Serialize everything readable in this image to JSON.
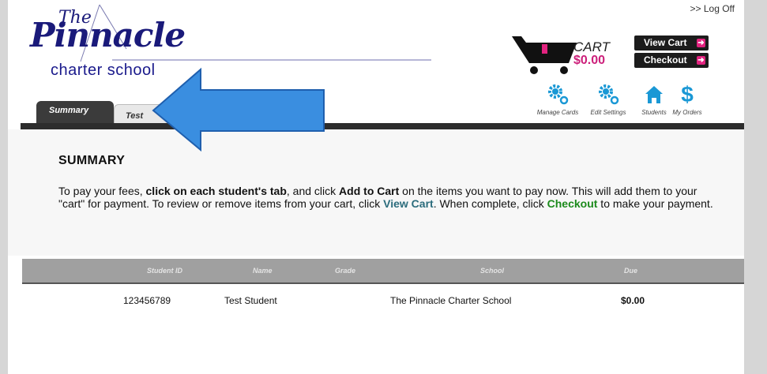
{
  "header": {
    "logo": {
      "the": "The",
      "name": "Pinnacle",
      "subtitle": "charter  school"
    },
    "logoff": ">> Log Off",
    "cart": {
      "label": "CART",
      "total": "$0.00"
    },
    "buttons": {
      "view_cart": "View Cart",
      "checkout": "Checkout",
      "arrow_glyph": "➜"
    },
    "icon_links": [
      {
        "label": "Manage Cards",
        "icon": "gear-icon"
      },
      {
        "label": "Edit Settings",
        "icon": "gear-icon"
      },
      {
        "label": "Students",
        "icon": "home-icon"
      },
      {
        "label": "My Orders",
        "icon": "dollar-icon"
      }
    ],
    "colors": {
      "accent": "#e2237f",
      "icon_blue": "#1a98d5",
      "dark": "#1c1c1c"
    }
  },
  "tabs": [
    {
      "label": "Summary",
      "active": true
    },
    {
      "label": "Test",
      "active": false
    }
  ],
  "summary": {
    "title": "SUMMARY",
    "instr": {
      "p1": "To pay your fees, ",
      "b1": "click on each student's tab",
      "p2": ", and click ",
      "b2": "Add to Cart",
      "p3": " on the items you want to pay now. This will add them to your \"cart\" for payment. To review or remove items from your cart, click ",
      "b3": "View Cart",
      "p4": ". When complete, click ",
      "b4": "Checkout",
      "p5": " to make your payment."
    }
  },
  "table": {
    "columns": [
      "Student ID",
      "Name",
      "Grade",
      "School",
      "Due"
    ],
    "rows": [
      {
        "student_id": "123456789",
        "name": "Test Student",
        "grade": "",
        "school": "The Pinnacle Charter School",
        "due": "$0.00"
      }
    ]
  }
}
